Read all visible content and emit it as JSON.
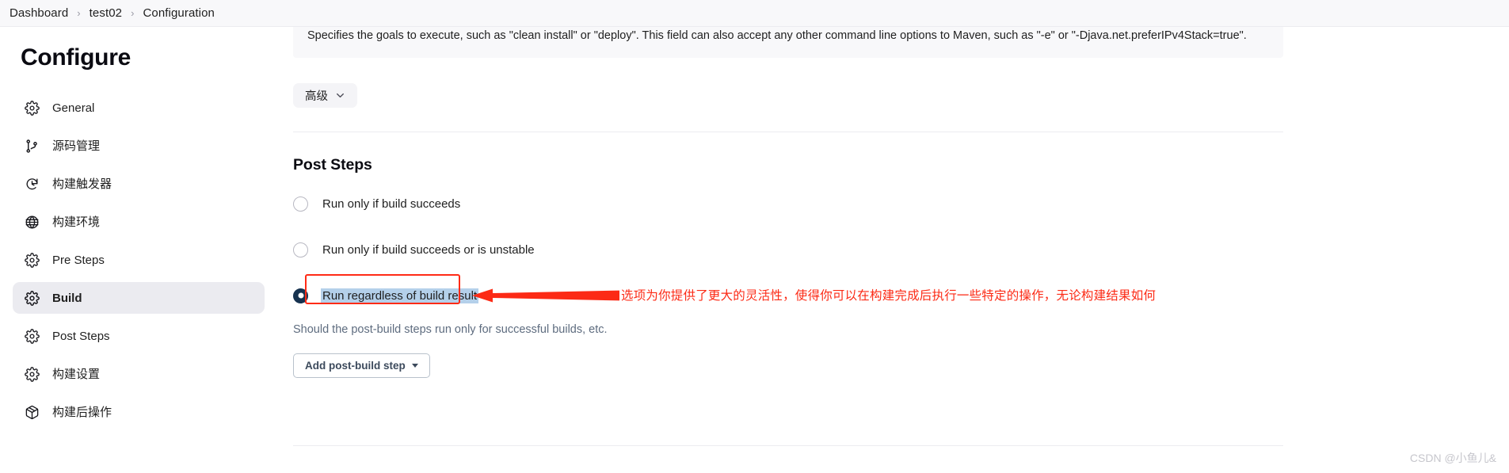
{
  "breadcrumb": {
    "items": [
      {
        "label": "Dashboard"
      },
      {
        "label": "test02"
      },
      {
        "label": "Configuration"
      }
    ],
    "separator": "›"
  },
  "sidebar": {
    "title": "Configure",
    "items": [
      {
        "label": "General",
        "icon": "gear-icon",
        "active": false
      },
      {
        "label": "源码管理",
        "icon": "branch-icon",
        "active": false
      },
      {
        "label": "构建触发器",
        "icon": "clock-icon",
        "active": false
      },
      {
        "label": "构建环境",
        "icon": "globe-icon",
        "active": false
      },
      {
        "label": "Pre Steps",
        "icon": "gear-icon",
        "active": false
      },
      {
        "label": "Build",
        "icon": "gear-icon",
        "active": true
      },
      {
        "label": "Post Steps",
        "icon": "gear-icon",
        "active": false
      },
      {
        "label": "构建设置",
        "icon": "gear-icon",
        "active": false
      },
      {
        "label": "构建后操作",
        "icon": "package-icon",
        "active": false
      }
    ]
  },
  "main": {
    "description": "Specifies the goals to execute, such as \"clean install\" or \"deploy\". This field can also accept any other command line options to Maven, such as \"-e\" or \"-Djava.net.preferIPv4Stack=true\".",
    "advanced_button": "高级",
    "post_steps": {
      "title": "Post Steps",
      "options": [
        {
          "label": "Run only if build succeeds",
          "checked": false
        },
        {
          "label": "Run only if build succeeds or is unstable",
          "checked": false
        },
        {
          "label": "Run regardless of build result",
          "checked": true
        }
      ],
      "helper_text": "Should the post-build steps run only for successful builds, etc.",
      "add_step_button": "Add post-build step"
    },
    "annotation": {
      "text": "选项为你提供了更大的灵活性，使得你可以在构建完成后执行一些特定的操作，无论构建结果如何",
      "color": "#fc2a15"
    }
  },
  "watermark": "CSDN @小鱼儿&",
  "colors": {
    "accent_selected_radio": "#16324f",
    "highlight_red": "#ff2b16",
    "text_selection": "#b4d0ea",
    "sidebar_active_bg": "#ebebf0"
  }
}
